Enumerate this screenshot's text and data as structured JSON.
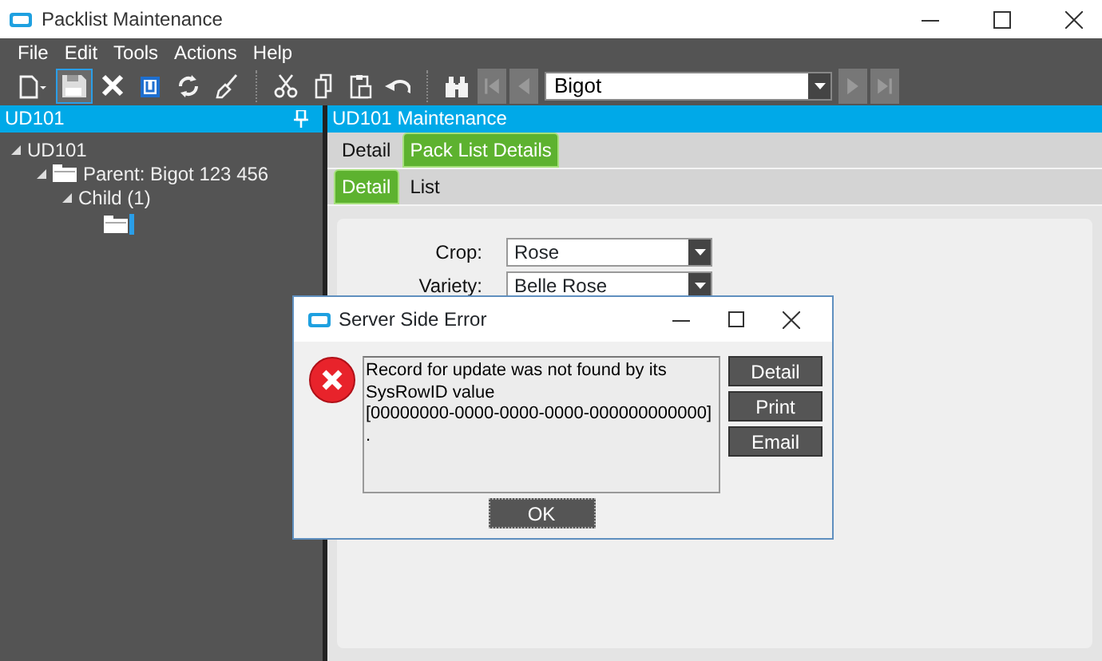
{
  "window": {
    "title": "Packlist Maintenance"
  },
  "menu": [
    "File",
    "Edit",
    "Tools",
    "Actions",
    "Help"
  ],
  "toolbar": [
    {
      "kind": "new",
      "selected": false,
      "disabled": false
    },
    {
      "kind": "save",
      "selected": true,
      "disabled": false
    },
    {
      "kind": "delete",
      "selected": false,
      "disabled": false
    },
    {
      "kind": "attach",
      "selected": false,
      "disabled": false
    },
    {
      "kind": "refresh",
      "selected": false,
      "disabled": false
    },
    {
      "kind": "clear",
      "selected": false,
      "disabled": false
    },
    {
      "kind": "separator"
    },
    {
      "kind": "cut",
      "selected": false,
      "disabled": false
    },
    {
      "kind": "copy",
      "selected": false,
      "disabled": false
    },
    {
      "kind": "paste",
      "selected": false,
      "disabled": false
    },
    {
      "kind": "undo",
      "selected": false,
      "disabled": false
    },
    {
      "kind": "separator"
    },
    {
      "kind": "search",
      "selected": false,
      "disabled": false
    },
    {
      "kind": "first",
      "selected": false,
      "disabled": true
    },
    {
      "kind": "previous",
      "selected": false,
      "disabled": true
    },
    {
      "kind": "combo",
      "value": "Bigot"
    },
    {
      "kind": "next",
      "selected": false,
      "disabled": true
    },
    {
      "kind": "last",
      "selected": false,
      "disabled": true
    }
  ],
  "tree_panel": {
    "title": "UD101",
    "nodes": [
      {
        "label": "UD101",
        "expanded": true,
        "selected": false,
        "children": [
          {
            "label": "Parent: Bigot 123 456",
            "kind": "folder",
            "expanded": true,
            "selected": false,
            "children": [
              {
                "label": "Child (1)",
                "expanded": true,
                "selected": false,
                "children": [
                  {
                    "kind": "folder",
                    "selected": true
                  }
                ]
              }
            ]
          }
        ]
      }
    ]
  },
  "main_panel": {
    "title": "UD101 Maintenance",
    "tabs": [
      {
        "label": "Detail",
        "selected": false
      },
      {
        "label": "Pack List Details",
        "selected": true
      }
    ],
    "subtabs": [
      {
        "label": "Detail",
        "selected": true
      },
      {
        "label": "List",
        "selected": false
      }
    ],
    "fields": [
      {
        "label": "Crop:",
        "value": "Rose"
      },
      {
        "label": "Variety:",
        "value": "Belle Rose"
      }
    ]
  },
  "dialog": {
    "title": "Server Side Error",
    "message": "Record for update was not found by its\nSysRowID value\n[00000000-0000-0000-0000-000000000000]\n.",
    "buttons": [
      "Detail",
      "Print",
      "Email"
    ],
    "ok": "OK"
  }
}
